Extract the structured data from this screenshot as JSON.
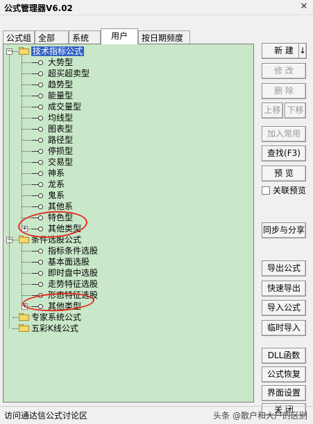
{
  "window": {
    "title": "公式管理器V6.02",
    "close_label": "✕"
  },
  "tabs": [
    {
      "label": "公式组"
    },
    {
      "label": "全部"
    },
    {
      "label": "系统"
    },
    {
      "label": "用户"
    },
    {
      "label": "按日期频度"
    }
  ],
  "active_tab": "用户",
  "tree": {
    "groups": [
      {
        "label": "技术指标公式",
        "expanded": true,
        "selected": true,
        "items": [
          "大势型",
          "超买超卖型",
          "趋势型",
          "能量型",
          "成交量型",
          "均线型",
          "图表型",
          "路径型",
          "停损型",
          "交易型",
          "神系",
          "龙系",
          "鬼系",
          "其他系",
          "特色型",
          "其他类型"
        ]
      },
      {
        "label": "条件选股公式",
        "expanded": true,
        "items": [
          "指标条件选股",
          "基本面选股",
          "即时盘中选股",
          "走势特征选股",
          "形态特征选股",
          "其他类型"
        ]
      },
      {
        "label": "专家系统公式",
        "expanded": false,
        "items": []
      },
      {
        "label": "五彩K线公式",
        "expanded": false,
        "items": []
      }
    ],
    "expander_collapsed": "+",
    "expander_expanded": "−"
  },
  "buttons": {
    "new": "新 建",
    "new_arrow": "↓",
    "modify": "修 改",
    "delete": "删 除",
    "move_up": "上移",
    "move_down": "下移",
    "add_common": "加入常用",
    "find": "查找(F3)",
    "preview": "预 览",
    "sync_share": "同步与分享",
    "export": "导出公式",
    "quick_export": "快速导出",
    "import": "导入公式",
    "temp_import": "临时导入",
    "dll": "DLL函数",
    "restore": "公式恢复",
    "ui_settings": "界面设置",
    "close": "关 闭"
  },
  "checkbox": {
    "label": "关联预览",
    "checked": false
  },
  "status": {
    "text": "访问通达信公式讨论区"
  },
  "watermark": "头条 @散户和大户的区别",
  "colors": {
    "tree_bg": "#c9e7c9",
    "selection": "#3161c4",
    "annotation": "#e42a20"
  }
}
